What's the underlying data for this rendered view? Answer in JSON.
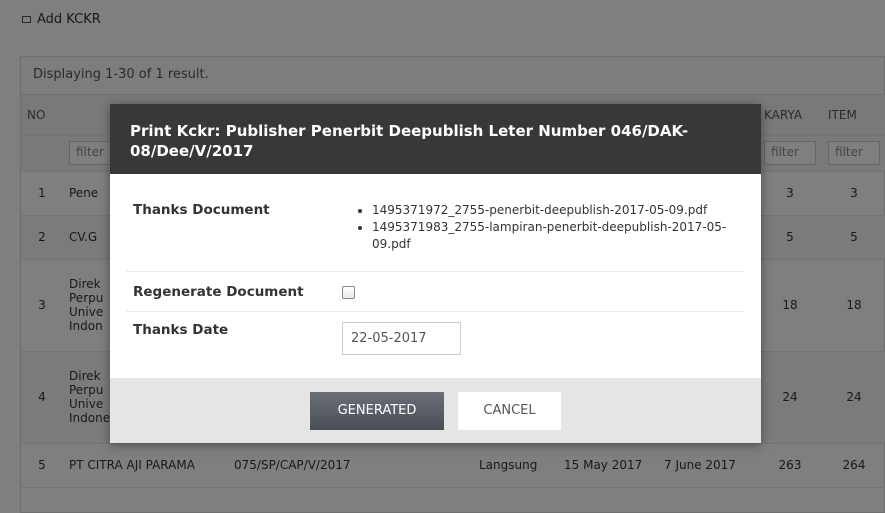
{
  "topbar": {
    "add_label": "Add KCKR"
  },
  "grid": {
    "summary": "Displaying 1-30 of 1 result.",
    "headers": {
      "no": "NO",
      "karya": "KARYA",
      "item": "ITEM"
    },
    "filter_placeholder": "filter",
    "rows": [
      {
        "no": "1",
        "publisher": "Pene",
        "letter": "",
        "type": "",
        "date1": "",
        "date2": "",
        "karya": "3",
        "item": "3"
      },
      {
        "no": "2",
        "publisher": "CV.G",
        "letter": "",
        "type": "",
        "date1": "",
        "date2": "",
        "karya": "5",
        "item": "5"
      },
      {
        "no": "3",
        "publisher": "Direk\nPerpu\nUnive\nIndon",
        "letter": "",
        "type": "",
        "date1": "",
        "date2": "",
        "karya": "18",
        "item": "18"
      },
      {
        "no": "4",
        "publisher": "Direk\nPerpu\nUnive\nIndonesia",
        "letter": "",
        "type": "",
        "date1": "",
        "date2": "",
        "karya": "24",
        "item": "24"
      },
      {
        "no": "5",
        "publisher": "PT CITRA AJI PARAMA",
        "letter": "075/SP/CAP/V/2017",
        "type": "Langsung",
        "date1": "15 May 2017",
        "date2": "7 June 2017",
        "karya": "263",
        "item": "264"
      }
    ]
  },
  "modal": {
    "title": "Print Kckr: Publisher Penerbit Deepublish Leter Number 046/DAK-08/Dee/V/2017",
    "thanks_document_label": "Thanks Document",
    "documents": [
      "1495371972_2755-penerbit-deepublish-2017-05-09.pdf",
      "1495371983_2755-lampiran-penerbit-deepublish-2017-05-09.pdf"
    ],
    "regenerate_label": "Regenerate Document",
    "regenerate_checked": false,
    "thanks_date_label": "Thanks Date",
    "thanks_date_value": "22-05-2017",
    "generated_button": "GENERATED",
    "cancel_button": "CANCEL"
  },
  "colors": {
    "header_bg": "#383838",
    "footer_bg": "#e5e5e5",
    "primary_btn": "#555a62",
    "overlay": "rgba(0,0,0,0.5)"
  }
}
